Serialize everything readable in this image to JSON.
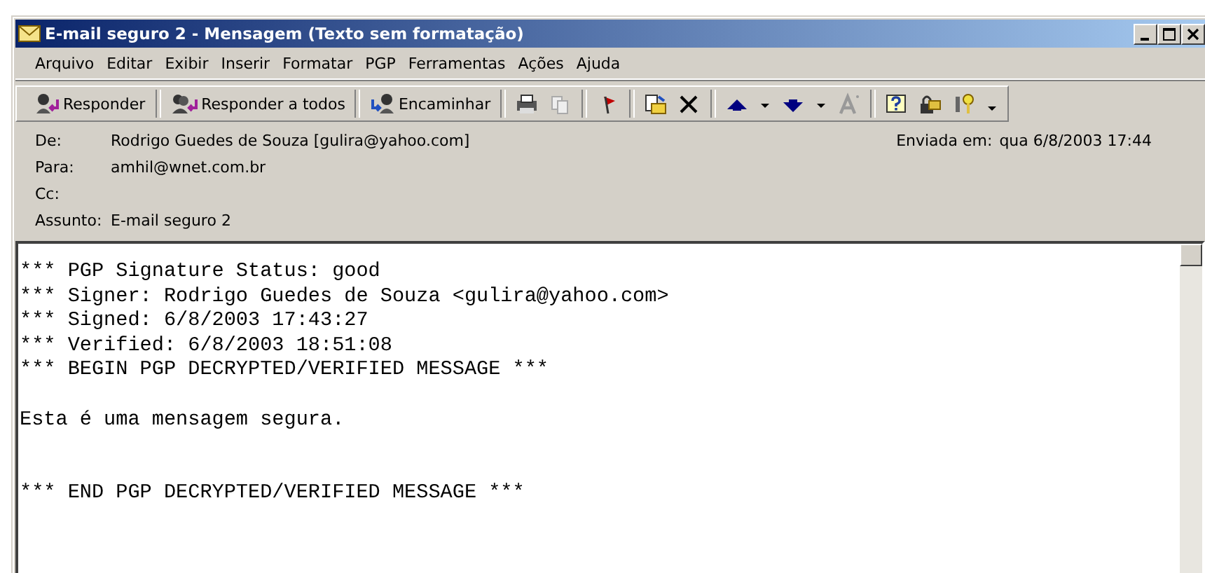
{
  "window": {
    "title": "E-mail seguro 2 - Mensagem (Texto sem formatação)"
  },
  "menu": [
    "Arquivo",
    "Editar",
    "Exibir",
    "Inserir",
    "Formatar",
    "PGP",
    "Ferramentas",
    "Ações",
    "Ajuda"
  ],
  "toolbar": [
    {
      "kind": "reply",
      "label": "Responder"
    },
    {
      "kind": "reply_all",
      "label": "Responder a todos"
    },
    {
      "kind": "forward",
      "label": "Encaminhar"
    }
  ],
  "header": {
    "fields": [
      {
        "label": "De:",
        "value": "Rodrigo Guedes de Souza [gulira@yahoo.com]"
      },
      {
        "label": "Para:",
        "value": "amhil@wnet.com.br"
      },
      {
        "label": "Cc:"
      },
      {
        "label": "Assunto:",
        "value": "E-mail seguro 2"
      }
    ],
    "sent_label": "Enviada em:",
    "sent_value": "qua 6/8/2003 17:44"
  },
  "body": {
    "sections": [
      [
        "*** PGP Signature Status: good",
        "*** Signer: Rodrigo Guedes de Souza <gulira@yahoo.com>",
        "*** Signed: 6/8/2003 17:43:27",
        "*** Verified: 6/8/2003 18:51:08",
        "*** BEGIN PGP DECRYPTED/VERIFIED MESSAGE ***"
      ],
      [
        "Esta é uma mensagem segura."
      ],
      [
        "*** END PGP DECRYPTED/VERIFIED MESSAGE ***"
      ]
    ]
  }
}
